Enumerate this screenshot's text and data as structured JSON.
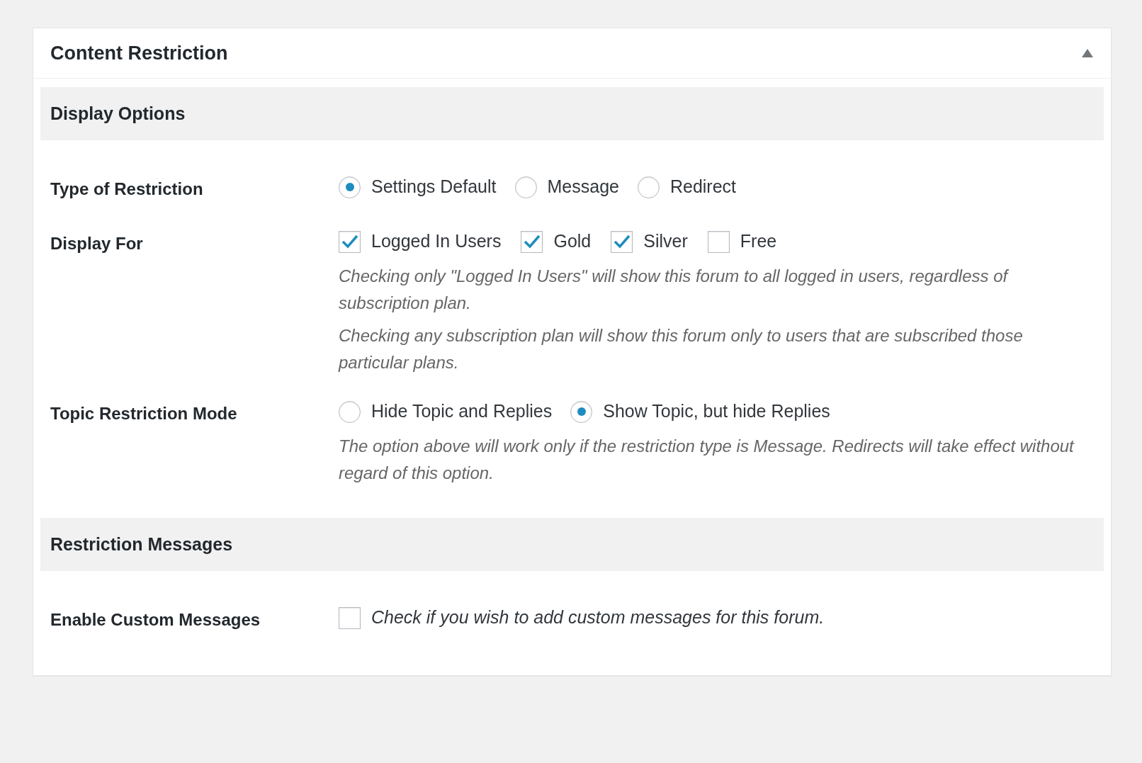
{
  "panel": {
    "title": "Content Restriction",
    "expanded": true
  },
  "sections": [
    {
      "heading": "Display Options",
      "rows": [
        {
          "label": "Type of Restriction",
          "kind": "radio",
          "options": [
            {
              "label": "Settings Default",
              "selected": true
            },
            {
              "label": "Message",
              "selected": false
            },
            {
              "label": "Redirect",
              "selected": false
            }
          ],
          "notes": []
        },
        {
          "label": "Display For",
          "kind": "checkbox",
          "options": [
            {
              "label": "Logged In Users",
              "checked": true
            },
            {
              "label": "Gold",
              "checked": true
            },
            {
              "label": "Silver",
              "checked": true
            },
            {
              "label": "Free",
              "checked": false
            }
          ],
          "notes": [
            "Checking only \"Logged In Users\" will show this forum to all logged in users, regardless of subscription plan.",
            "Checking any subscription plan will show this forum only to users that are subscribed those particular plans."
          ]
        },
        {
          "label": "Topic Restriction Mode",
          "kind": "radio",
          "options": [
            {
              "label": "Hide Topic and Replies",
              "selected": false
            },
            {
              "label": "Show Topic, but hide Replies",
              "selected": true
            }
          ],
          "notes": [
            "The option above will work only if the restriction type is Message. Redirects will take effect without regard of this option."
          ]
        }
      ]
    },
    {
      "heading": "Restriction Messages",
      "rows": [
        {
          "label": "Enable Custom Messages",
          "kind": "check_description",
          "options": [
            {
              "label": "Check if you wish to add custom messages for this forum.",
              "checked": false
            }
          ],
          "notes": []
        }
      ]
    }
  ]
}
